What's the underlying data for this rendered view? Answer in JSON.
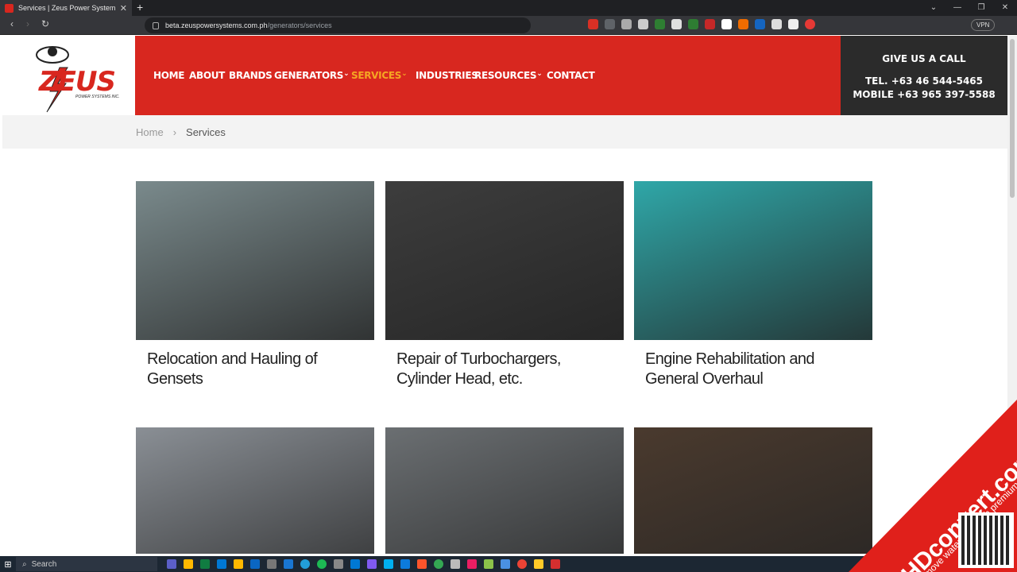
{
  "browser": {
    "tab_title": "Services | Zeus Power Systems",
    "url_host": "beta.zeuspowersystems.com.ph",
    "url_path": "/generators/services",
    "vpn_label": "VPN"
  },
  "header": {
    "logo_text": "ZEUS",
    "logo_sub": "POWER SYSTEMS INC.",
    "menu": [
      {
        "label": "HOME"
      },
      {
        "label": "ABOUT"
      },
      {
        "label": "BRANDS"
      },
      {
        "label": "GENERATORS",
        "dropdown": true
      },
      {
        "label": "SERVICES",
        "dropdown": true,
        "active": true
      },
      {
        "label": "INDUSTRIES"
      },
      {
        "label": "RESOURCES",
        "dropdown": true
      },
      {
        "label": "CONTACT"
      }
    ],
    "call": {
      "heading": "GIVE US A CALL",
      "tel": "TEL. +63 46 544-5465",
      "mobile": "MOBILE +63 965 397-5588"
    }
  },
  "breadcrumb": {
    "home": "Home",
    "sep": "›",
    "current": "Services"
  },
  "services": [
    {
      "title": "Relocation and Hauling of Gensets",
      "color": "#7a8a8c"
    },
    {
      "title": "Repair of Turbochargers, Cylinder Head, etc.",
      "color": "#3d3d3d"
    },
    {
      "title": "Engine Rehabilitation and General Overhaul",
      "color": "#2fa7a8"
    },
    {
      "title": "",
      "color": "#8a8f95"
    },
    {
      "title": "",
      "color": "#6b6f72"
    },
    {
      "title": "",
      "color": "#4a3a2e"
    }
  ],
  "taskbar": {
    "search_label": "Search"
  },
  "watermark": {
    "brand": "HDconvert.com",
    "sub": "remove watermark with premium"
  },
  "colors": {
    "brand_red": "#d8271f",
    "active_orange": "#f5a623",
    "dark": "#2b2b2b"
  }
}
